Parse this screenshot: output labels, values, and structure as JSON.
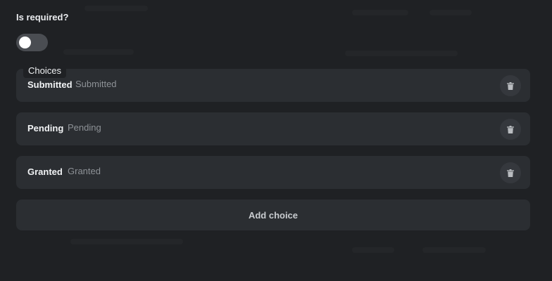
{
  "form": {
    "required_label": "Is required?",
    "required_toggle": {
      "on": false
    },
    "choices_label": "Choices",
    "choices": [
      {
        "label": "Submitted",
        "value": "Submitted",
        "delete_icon": "trash-icon"
      },
      {
        "label": "Pending",
        "value": "Pending",
        "delete_icon": "trash-icon"
      },
      {
        "label": "Granted",
        "value": "Granted",
        "delete_icon": "trash-icon"
      }
    ],
    "add_choice_label": "Add choice"
  },
  "colors": {
    "background": "#1f2124",
    "row_background": "#2b2e32",
    "toggle_track": "#4a4d52",
    "toggle_knob": "#ffffff",
    "label_text": "#f1f3f5",
    "value_text": "#8e9297",
    "icon_button": "#35383d",
    "icon": "#b9bcc0"
  }
}
